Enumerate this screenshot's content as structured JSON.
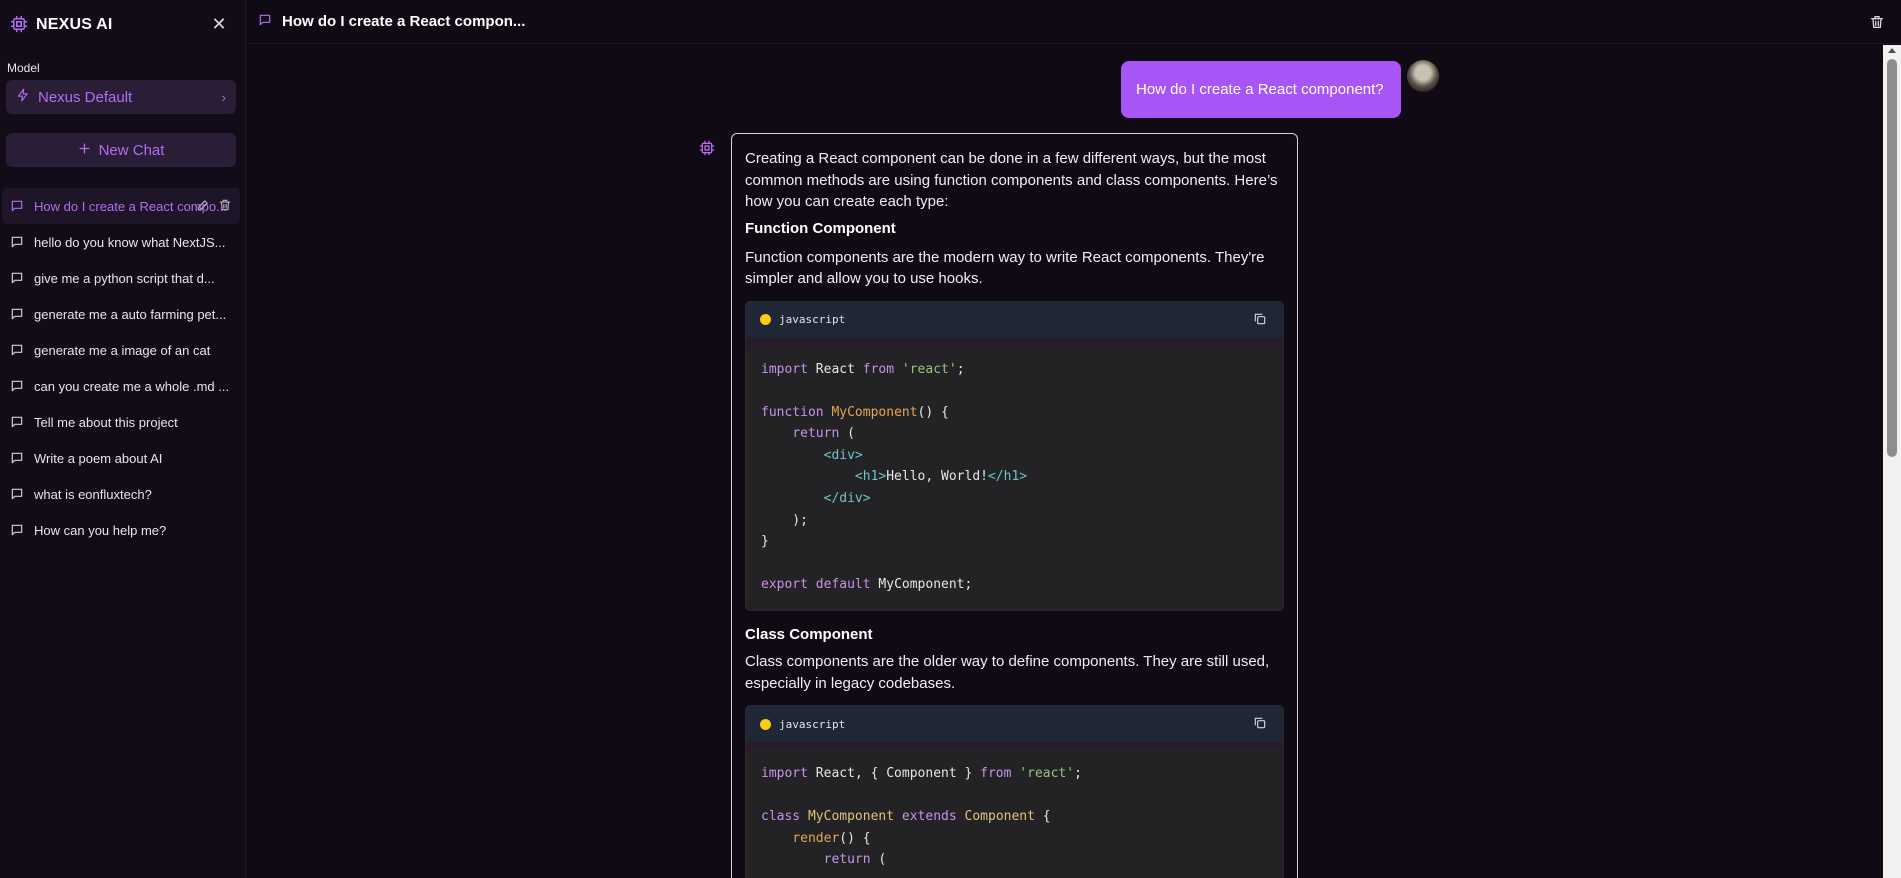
{
  "brand": {
    "name": "NEXUS AI"
  },
  "sidebar": {
    "model_label": "Model",
    "model_value": "Nexus Default",
    "new_chat_label": "New Chat",
    "chats": [
      {
        "label": "How do I create a React compo..."
      },
      {
        "label": "hello do you know what NextJS..."
      },
      {
        "label": "give me a python script that d..."
      },
      {
        "label": "generate me a auto farming pet..."
      },
      {
        "label": "generate me a image of an cat"
      },
      {
        "label": "can you create me a whole .md ..."
      },
      {
        "label": "Tell me about this project"
      },
      {
        "label": "Write a poem about AI"
      },
      {
        "label": "what is eonfluxtech?"
      },
      {
        "label": "How can you help me?"
      }
    ]
  },
  "header": {
    "title": "How do I create a React compon..."
  },
  "conversation": {
    "user_message": "How do I create a React component?",
    "bot": {
      "intro": "Creating a React component can be done in a few different ways, but the most common methods are using function components and class components. Here’s how you can create each type:",
      "function_heading": "Function Component",
      "function_desc": "Function components are the modern way to write React components. They're simpler and allow you to use hooks.",
      "code1_lang": "javascript",
      "class_heading": "Class Component",
      "class_desc": "Class components are the older way to define components. They are still used, especially in legacy codebases.",
      "code2_lang": "javascript"
    }
  },
  "colors": {
    "accent": "#a855f7",
    "accent_text": "#b46cf0",
    "background": "#0f0a14"
  }
}
